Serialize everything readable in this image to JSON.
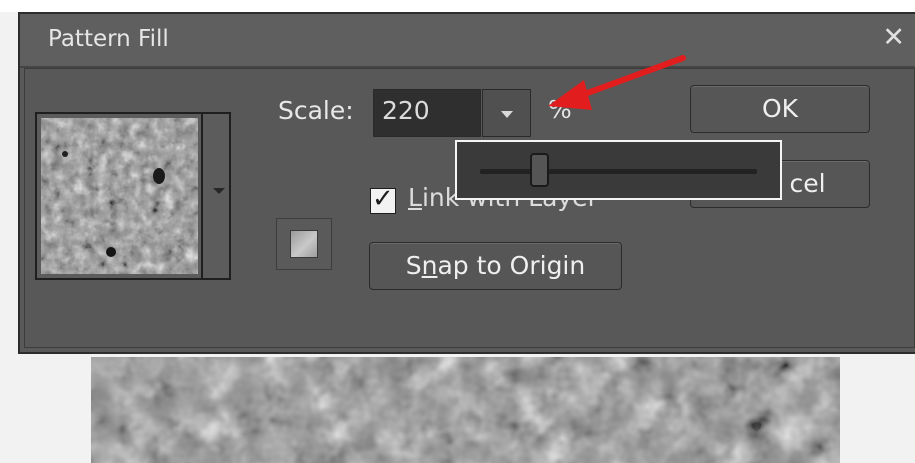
{
  "dialog": {
    "title": "Pattern Fill",
    "close_glyph": "✕"
  },
  "scale": {
    "label": "Scale:",
    "value": "220",
    "unit": "%",
    "slider_fraction": 0.215
  },
  "buttons": {
    "ok": "OK",
    "cancel": "cel",
    "snap_pre": "S",
    "snap_accel": "n",
    "snap_post": "ap to Origin"
  },
  "link_with_layer": {
    "checked": true,
    "check_glyph": "✓",
    "accel": "L",
    "rest": "ink with Layer"
  },
  "icons": {
    "pattern_picker_arrow": "chevron-down-icon",
    "scale_dropdown": "chevron-down-icon",
    "snap_origin": "origin-square-icon",
    "annotation": "red-arrow-icon"
  },
  "colors": {
    "dialog_bg": "#595959",
    "annotation_arrow": "#e11d1d"
  }
}
